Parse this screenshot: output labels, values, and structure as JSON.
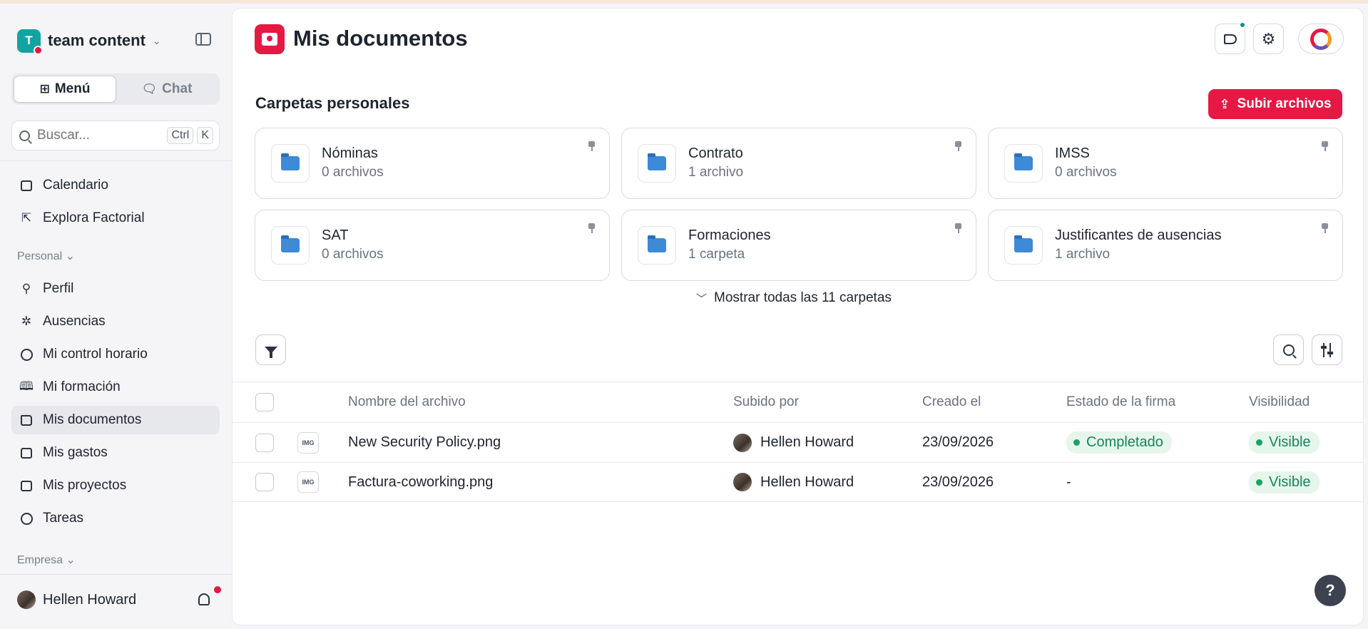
{
  "workspace": {
    "logo_letter": "T",
    "name": "team content"
  },
  "segments": {
    "menu": "Menú",
    "chat": "Chat"
  },
  "search": {
    "placeholder": "Buscar...",
    "kbd_ctrl": "Ctrl",
    "kbd_k": "K"
  },
  "nav_top": [
    "Calendario",
    "Explora Factorial"
  ],
  "section_personal": "Personal",
  "nav_personal": [
    "Perfil",
    "Ausencias",
    "Mi control horario",
    "Mi formación",
    "Mis documentos",
    "Mis gastos",
    "Mis proyectos",
    "Tareas"
  ],
  "section_empresa": "Empresa",
  "user": {
    "name": "Hellen Howard"
  },
  "page": {
    "title": "Mis documentos"
  },
  "folders_section": {
    "title": "Carpetas personales",
    "upload_label": "Subir archivos",
    "show_all": "Mostrar todas las 11 carpetas"
  },
  "folders": [
    {
      "name": "Nóminas",
      "count": "0 archivos"
    },
    {
      "name": "Contrato",
      "count": "1 archivo"
    },
    {
      "name": "IMSS",
      "count": "0 archivos"
    },
    {
      "name": "SAT",
      "count": "0 archivos"
    },
    {
      "name": "Formaciones",
      "count": "1 carpeta"
    },
    {
      "name": "Justificantes de ausencias",
      "count": "1 archivo"
    }
  ],
  "table": {
    "columns": {
      "name": "Nombre del archivo",
      "uploaded_by": "Subido por",
      "created": "Creado el",
      "signature": "Estado de la firma",
      "visibility": "Visibilidad"
    },
    "rows": [
      {
        "type": "IMG",
        "name": "New Security Policy.png",
        "uploaded_by": "Hellen Howard",
        "created": "23/09/2026",
        "signature": "Completado",
        "visibility": "Visible"
      },
      {
        "type": "IMG",
        "name": "Factura-coworking.png",
        "uploaded_by": "Hellen Howard",
        "created": "23/09/2026",
        "signature": "-",
        "visibility": "Visible"
      }
    ]
  },
  "help": "?",
  "colors": {
    "brand": "#e51943",
    "teal": "#12a3a3",
    "folder": "#3d8ad6",
    "success": "#13875a"
  }
}
